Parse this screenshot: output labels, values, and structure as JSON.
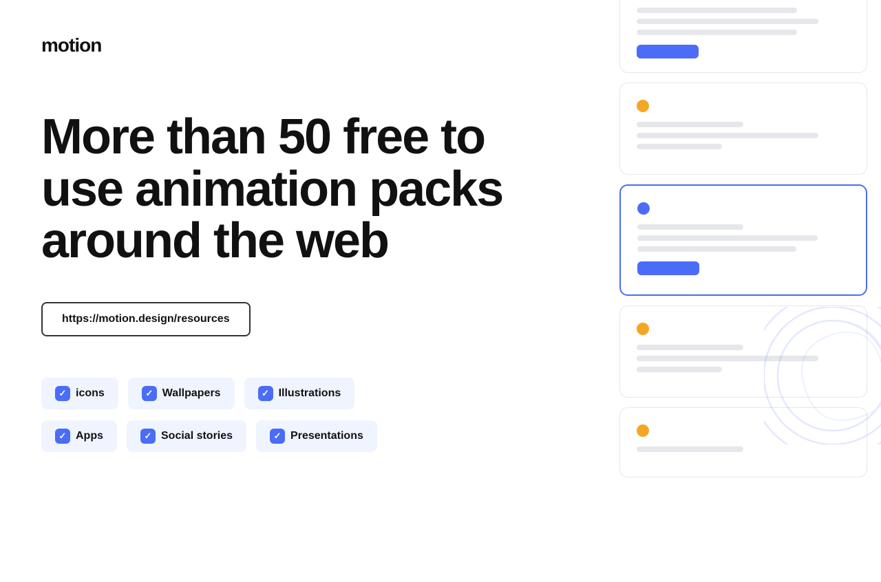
{
  "logo": {
    "text": "motion"
  },
  "headline": {
    "text": "More than 50 free to use animation packs around the web"
  },
  "cta": {
    "label": "https://motion.design/resources",
    "url": "https://motion.design/resources"
  },
  "tags": {
    "row1": [
      {
        "label": "icons"
      },
      {
        "label": "Wallpapers"
      },
      {
        "label": "Illustrations"
      }
    ],
    "row2": [
      {
        "label": "Apps"
      },
      {
        "label": "Social stories"
      },
      {
        "label": "Presentations"
      }
    ]
  },
  "cards": [
    {
      "id": "card-top-partial",
      "type": "partial",
      "dot": null,
      "lines": [
        "medium",
        "long",
        "medium"
      ],
      "hasButton": true
    },
    {
      "id": "card-2",
      "type": "normal",
      "dot": "yellow",
      "lines": [
        "short",
        "long",
        "xshort"
      ],
      "hasButton": false
    },
    {
      "id": "card-3",
      "type": "highlighted",
      "dot": "blue",
      "lines": [
        "short",
        "long",
        "medium"
      ],
      "hasButton": true
    },
    {
      "id": "card-4",
      "type": "normal",
      "dot": "yellow",
      "lines": [
        "short",
        "long",
        "xshort"
      ],
      "hasButton": false
    },
    {
      "id": "card-5",
      "type": "normal",
      "dot": "yellow",
      "lines": [
        "short"
      ],
      "hasButton": false
    }
  ]
}
